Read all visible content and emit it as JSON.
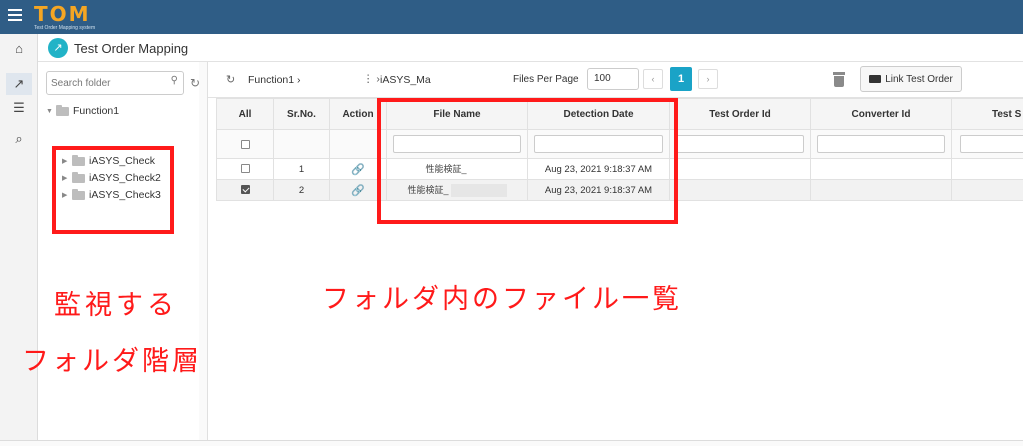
{
  "app": {
    "logo_text": "TOM",
    "logo_subtitle": "Test Order Mapping system"
  },
  "rail": {
    "icons": [
      "home-icon",
      "external-link-icon",
      "list-icon",
      "search-icon"
    ]
  },
  "page": {
    "title": "Test Order Mapping"
  },
  "folder_panel": {
    "search_placeholder": "Search folder",
    "root": "Function1",
    "children": [
      "iASYS_Check",
      "iASYS_Check2",
      "iASYS_Check3"
    ]
  },
  "toolbar": {
    "breadcrumb_1": "Function1",
    "breadcrumb_sep": "›",
    "breadcrumb_more": "⋮ ›",
    "breadcrumb_2": "iASYS_Ma",
    "files_per_page_label": "Files Per Page",
    "files_per_page_value": "100",
    "prev": "‹",
    "current_page": "1",
    "next": "›",
    "link_button": "Link Test Order"
  },
  "table": {
    "headers": {
      "all": "All",
      "srno": "Sr.No.",
      "action": "Action",
      "file_name": "File Name",
      "detection_date": "Detection Date",
      "test_order_id": "Test Order Id",
      "converter_id": "Converter Id",
      "test_s": "Test S"
    },
    "rows": [
      {
        "checked": false,
        "srno": "1",
        "file_name": "性能検証_",
        "detection_date": "Aug 23, 2021 9:18:37 AM"
      },
      {
        "checked": true,
        "srno": "2",
        "file_name": "性能検証_",
        "detection_date": "Aug 23, 2021 9:18:37 AM"
      }
    ]
  },
  "annotations": {
    "folder_caption_line1": "監視する",
    "folder_caption_line2": "フォルダ階層",
    "files_caption": "フォルダ内のファイル一覧",
    "highlight_color": "#ff1a1a"
  }
}
